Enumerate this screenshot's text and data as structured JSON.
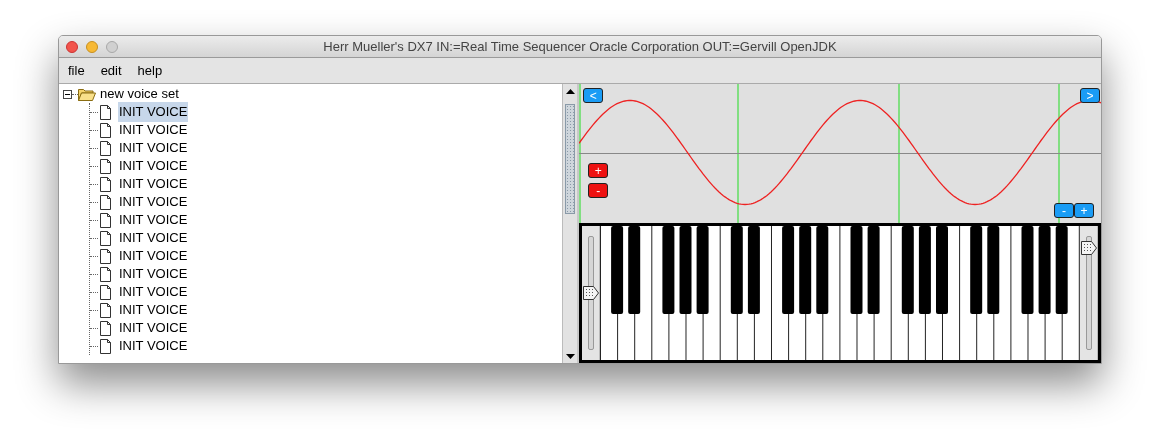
{
  "window": {
    "title": "Herr Mueller's DX7 IN:=Real Time Sequencer Oracle Corporation OUT:=Gervill OpenJDK"
  },
  "menu": [
    "file",
    "edit",
    "help"
  ],
  "tree": {
    "label": "new voice set",
    "expanded": true,
    "children": [
      {
        "label": "INIT VOICE",
        "selected": true
      },
      {
        "label": "INIT VOICE",
        "selected": false
      },
      {
        "label": "INIT VOICE",
        "selected": false
      },
      {
        "label": "INIT VOICE",
        "selected": false
      },
      {
        "label": "INIT VOICE",
        "selected": false
      },
      {
        "label": "INIT VOICE",
        "selected": false
      },
      {
        "label": "INIT VOICE",
        "selected": false
      },
      {
        "label": "INIT VOICE",
        "selected": false
      },
      {
        "label": "INIT VOICE",
        "selected": false
      },
      {
        "label": "INIT VOICE",
        "selected": false
      },
      {
        "label": "INIT VOICE",
        "selected": false
      },
      {
        "label": "INIT VOICE",
        "selected": false
      },
      {
        "label": "INIT VOICE",
        "selected": false
      },
      {
        "label": "INIT VOICE",
        "selected": false
      }
    ]
  },
  "wave": {
    "scroll_left": "<",
    "scroll_right": ">",
    "amp_up": "+",
    "amp_down": "-",
    "zoom_out": "-",
    "zoom_in": "+"
  },
  "keyboard": {
    "left_slider": {
      "level": 0.5
    },
    "right_slider": {
      "level": 0.9
    }
  }
}
